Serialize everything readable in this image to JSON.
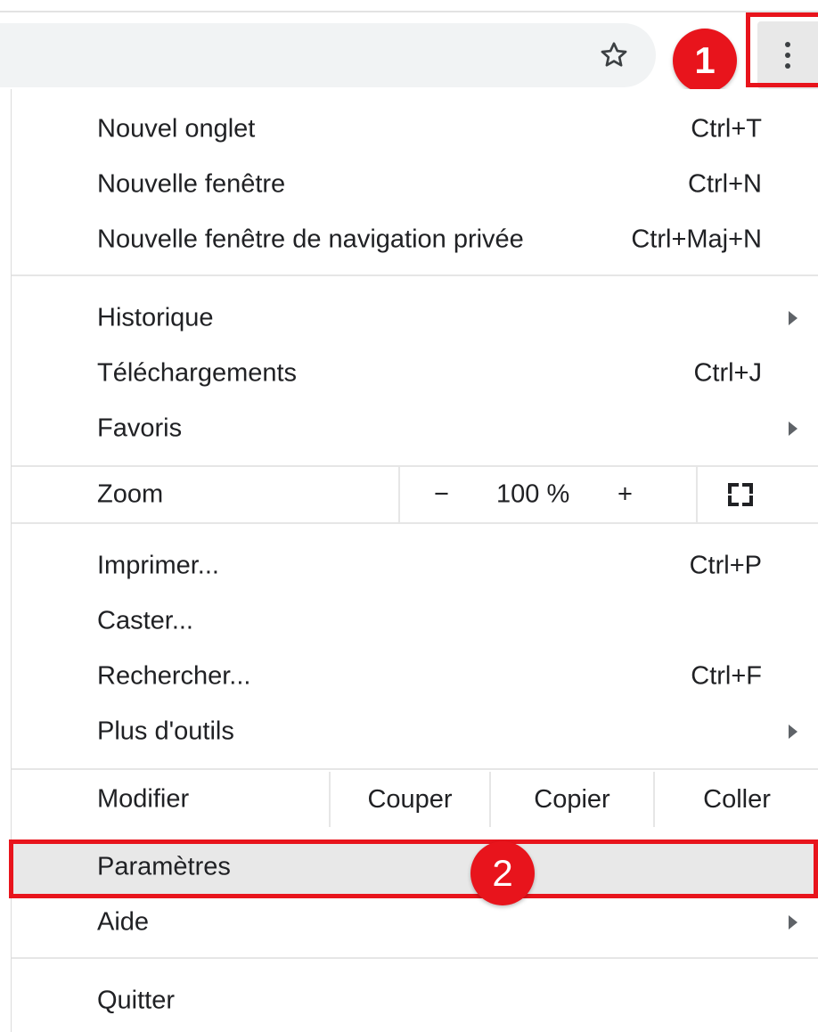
{
  "toolbar": {
    "star_icon": "star-outline-icon",
    "menu_icon": "kebab-menu-icon"
  },
  "annotations": {
    "step1": "1",
    "step2": "2",
    "color": "#e8141c"
  },
  "menu": {
    "new_tab": {
      "label": "Nouvel onglet",
      "shortcut": "Ctrl+T"
    },
    "new_window": {
      "label": "Nouvelle fenêtre",
      "shortcut": "Ctrl+N"
    },
    "incognito": {
      "label": "Nouvelle fenêtre de navigation privée",
      "shortcut": "Ctrl+Maj+N"
    },
    "history": {
      "label": "Historique"
    },
    "downloads": {
      "label": "Téléchargements",
      "shortcut": "Ctrl+J"
    },
    "bookmarks": {
      "label": "Favoris"
    },
    "zoom": {
      "label": "Zoom",
      "minus": "−",
      "value": "100 %",
      "plus": "+",
      "fullscreen_icon": "fullscreen-icon"
    },
    "print": {
      "label": "Imprimer...",
      "shortcut": "Ctrl+P"
    },
    "cast": {
      "label": "Caster..."
    },
    "find": {
      "label": "Rechercher...",
      "shortcut": "Ctrl+F"
    },
    "more_tools": {
      "label": "Plus d'outils"
    },
    "edit": {
      "label": "Modifier",
      "cut": "Couper",
      "copy": "Copier",
      "paste": "Coller"
    },
    "settings": {
      "label": "Paramètres"
    },
    "help": {
      "label": "Aide"
    },
    "quit": {
      "label": "Quitter"
    }
  }
}
